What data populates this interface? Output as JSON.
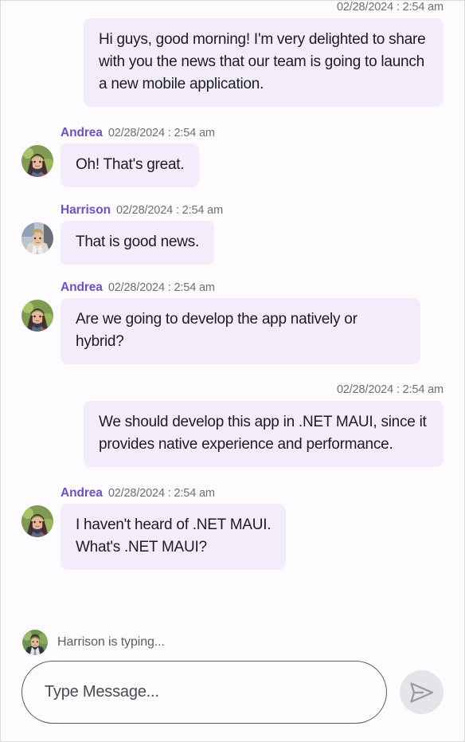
{
  "window": {
    "background_color": "#FDFBFE",
    "bubble_color": "#F2ECFB",
    "sender_name_color": "#6E50C0",
    "timestamp_color": "#6F6F74",
    "send_button_color": "#E6E4E8"
  },
  "conversation": {
    "messages": [
      {
        "direction": "outgoing",
        "sender": "",
        "timestamp": "02/28/2024 : 2:54 am",
        "text": "Hi guys, good morning! I'm very delighted to share with you the news that our team is going to launch a new mobile application.",
        "avatar": "none"
      },
      {
        "direction": "incoming",
        "sender": "Andrea",
        "timestamp": "02/28/2024 : 2:54 am",
        "text": "Oh! That's great.",
        "avatar": "andrea-avatar"
      },
      {
        "direction": "incoming",
        "sender": "Harrison",
        "timestamp": "02/28/2024 : 2:54 am",
        "text": "That is good news.",
        "avatar": "harrison-avatar"
      },
      {
        "direction": "incoming",
        "sender": "Andrea",
        "timestamp": "02/28/2024 : 2:54 am",
        "text": "Are we going to develop the app natively or hybrid?",
        "avatar": "andrea-avatar"
      },
      {
        "direction": "outgoing",
        "sender": "",
        "timestamp": "02/28/2024 : 2:54 am",
        "text": "We should develop this app in .NET MAUI, since it provides native experience and performance.",
        "avatar": "none"
      },
      {
        "direction": "incoming",
        "sender": "Andrea",
        "timestamp": "02/28/2024 : 2:54 am",
        "text": "I haven't heard of .NET MAUI.\nWhat's .NET MAUI?",
        "avatar": "andrea-avatar"
      }
    ]
  },
  "footer": {
    "typing_indicator": "Harrison is typing...",
    "typing_avatar": "harrison-typing-avatar",
    "input_placeholder": "Type Message...",
    "input_value": "",
    "send_icon": "send-icon"
  }
}
